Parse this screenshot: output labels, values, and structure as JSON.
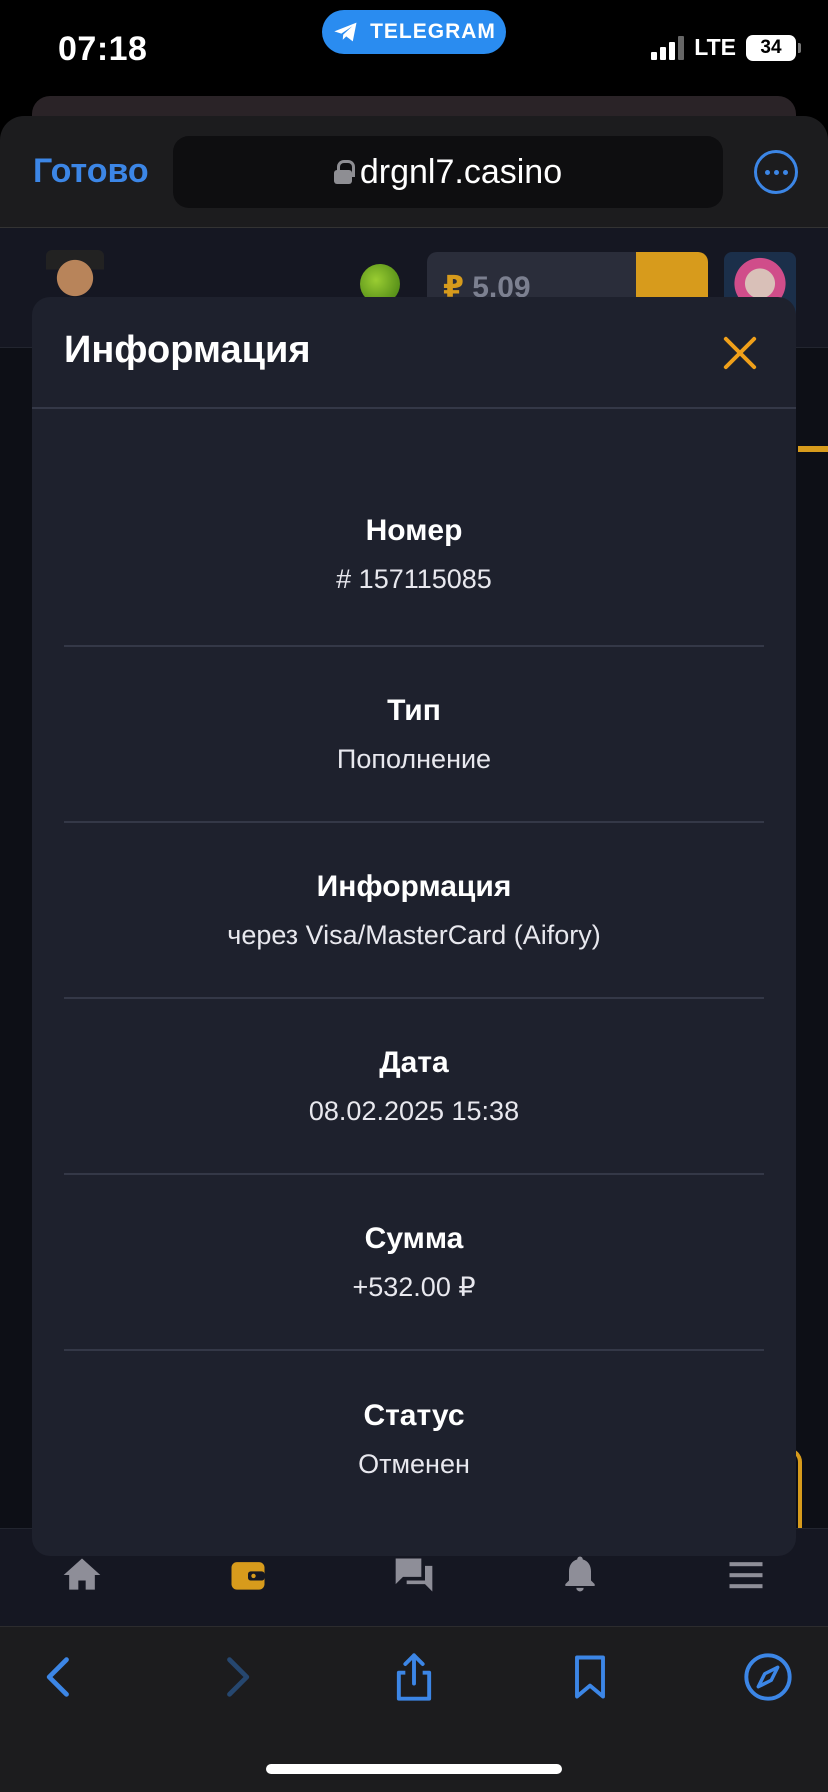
{
  "status_bar": {
    "time": "07:18",
    "telegram_label": "TELEGRAM",
    "network": "LTE",
    "battery": "34"
  },
  "browser": {
    "done_label": "Готово",
    "url": "drgnl7.casino"
  },
  "site_header": {
    "balance_currency": "₽",
    "balance_value": "5.09"
  },
  "modal": {
    "title": "Информация",
    "rows": [
      {
        "label": "Номер",
        "value": "# 157115085"
      },
      {
        "label": "Тип",
        "value": "Пополнение"
      },
      {
        "label": "Информация",
        "value": "через Visa/MasterCard (Aifory)"
      },
      {
        "label": "Дата",
        "value": "08.02.2025 15:38"
      },
      {
        "label": "Сумма",
        "value": "+532.00 ₽"
      },
      {
        "label": "Статус",
        "value": "Отменен"
      }
    ]
  },
  "bottom_nav": {
    "items": [
      "home-icon",
      "wallet-icon",
      "chat-icon",
      "bell-icon",
      "menu-icon"
    ]
  },
  "toolbar": {
    "items": [
      "back-icon",
      "forward-icon",
      "share-icon",
      "bookmarks-icon",
      "compass-icon"
    ]
  },
  "colors": {
    "accent": "#f0a01a",
    "link": "#3c86e6",
    "modal_bg": "#1e212d"
  }
}
